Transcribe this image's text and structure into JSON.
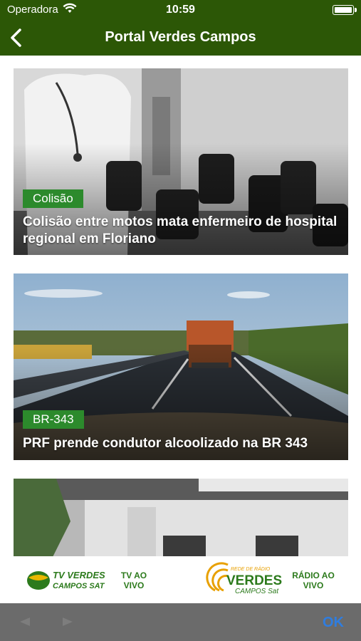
{
  "statusbar": {
    "carrier": "Operadora",
    "time": "10:59"
  },
  "navbar": {
    "title": "Portal Verdes Campos",
    "back_icon": "chevron-left-icon"
  },
  "feed": {
    "articles": [
      {
        "category": "Colisão",
        "headline": "Colisão entre motos mata enfermeiro de hospital regional em Floriano"
      },
      {
        "category": "BR-343",
        "headline": "PRF prende condutor alcoolizado na BR 343"
      },
      {
        "category": "",
        "headline": ""
      }
    ]
  },
  "bottombar": {
    "tv_logo_text": [
      "TV VERDES",
      "CAMPOS SAT"
    ],
    "tv_label": "TV AO VIVO",
    "radio_logo_text": [
      "REDE DE RÁDIO",
      "VERDES",
      "CAMPOS Sat"
    ],
    "radio_label": "RÁDIO AO VIVO"
  },
  "toolbar": {
    "ok_label": "OK"
  },
  "colors": {
    "brand_green": "#2c5706",
    "badge_green": "#2c8a2c",
    "ok_blue": "#2f7de0"
  }
}
